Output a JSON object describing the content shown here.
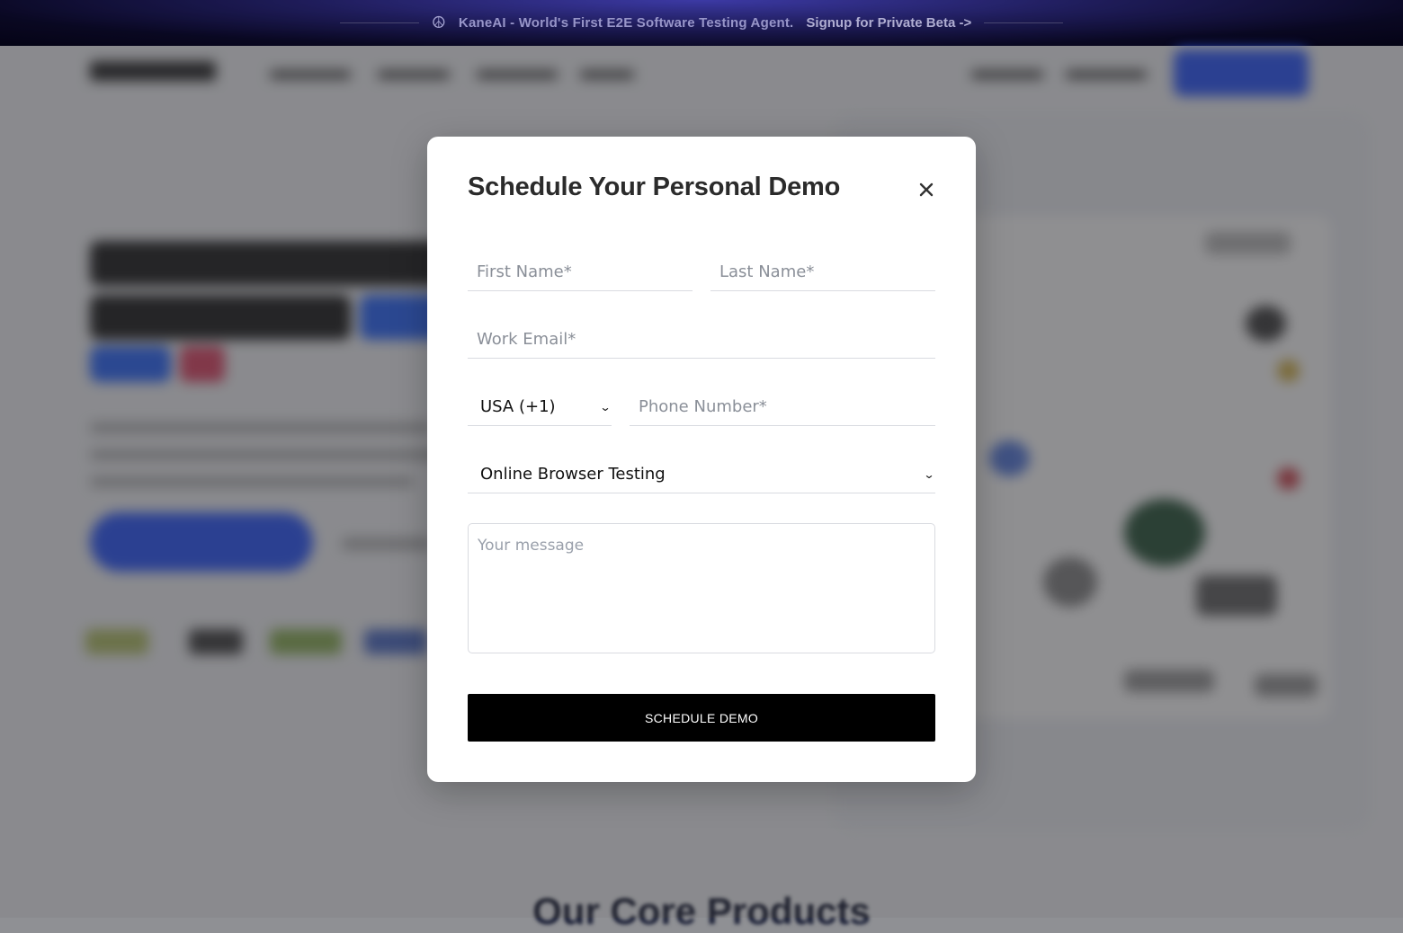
{
  "banner": {
    "icon": "kaneai-icon",
    "text": "KaneAI - World's First E2E Software Testing Agent.",
    "link": "Signup for Private Beta ->"
  },
  "background": {
    "section_title": "Our Core Products"
  },
  "modal": {
    "title": "Schedule Your Personal Demo",
    "close_icon": "close-icon",
    "first_name_placeholder": "First Name*",
    "last_name_placeholder": "Last Name*",
    "work_email_placeholder": "Work Email*",
    "country_code": {
      "selected": "USA (+1)"
    },
    "phone_placeholder": "Phone Number*",
    "product": {
      "selected": "Online Browser Testing"
    },
    "message_placeholder": "Your message",
    "submit_label": "SCHEDULE DEMO"
  }
}
